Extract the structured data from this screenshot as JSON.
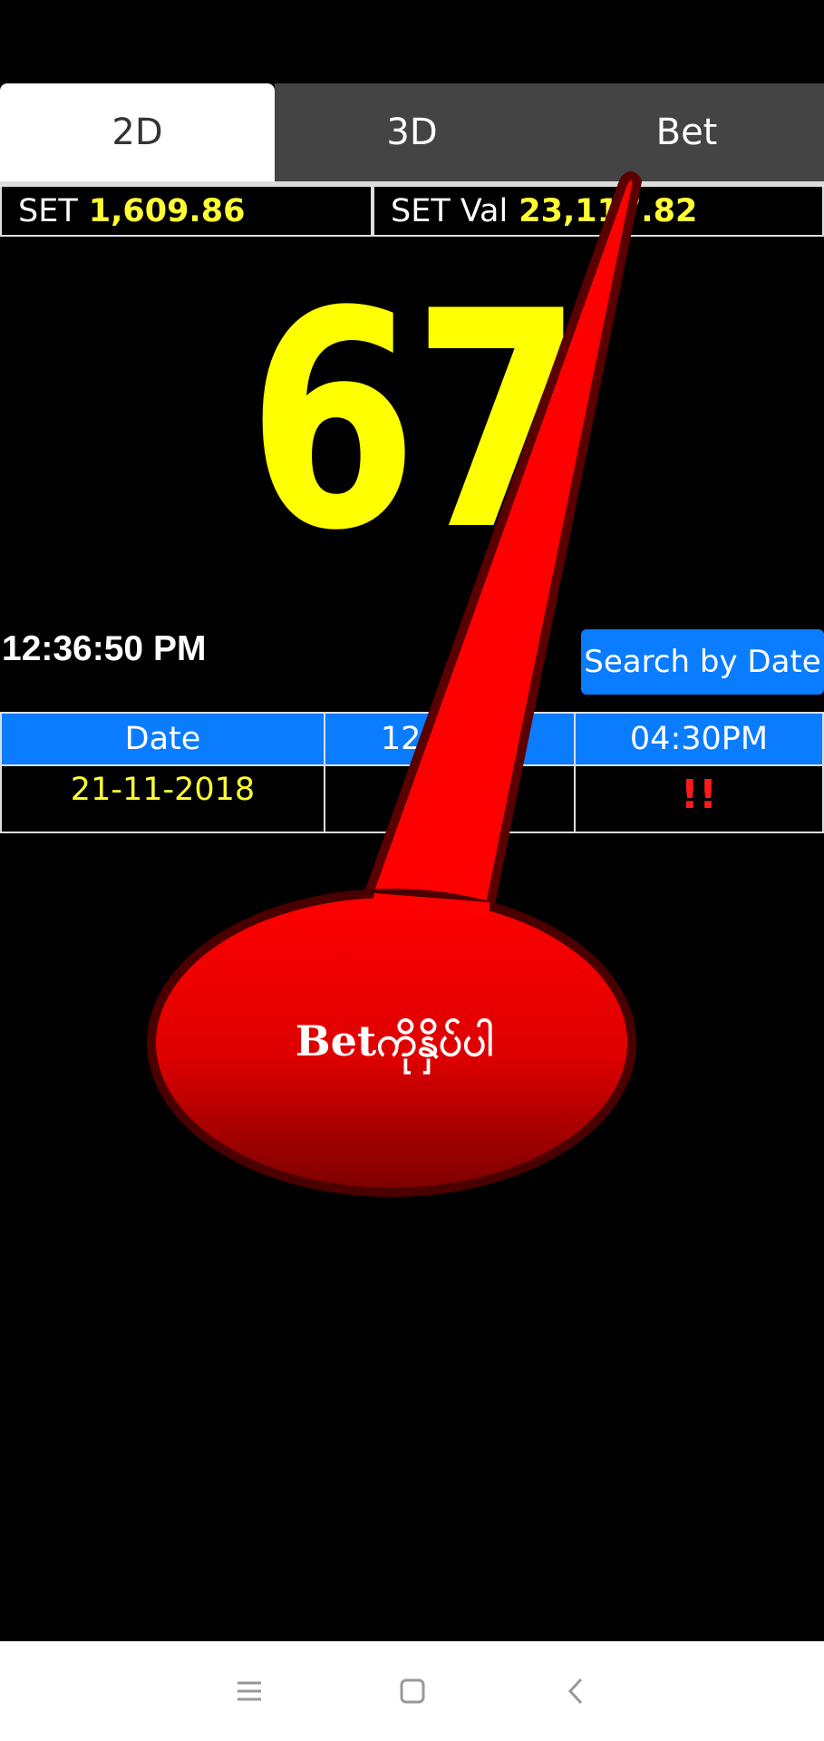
{
  "tabs": [
    {
      "label": "2D",
      "active": true
    },
    {
      "label": "3D",
      "active": false
    },
    {
      "label": "Bet",
      "active": false
    }
  ],
  "set_info": {
    "set_label": "SET",
    "set_value": "1,609.86",
    "set_val_label": "SET Val",
    "set_val_value": "23,117.82"
  },
  "result_number": "67",
  "clock": "12:36:50 PM",
  "search_button": "Search by Date",
  "results_table": {
    "headers": [
      "Date",
      "12:01PM",
      "04:30PM"
    ],
    "rows": [
      {
        "date": "21-11-2018",
        "noon": "",
        "evening": "!!"
      }
    ]
  },
  "callout": {
    "text": "Betကိုနှိပ်ပါ",
    "color": "#ff0000"
  },
  "colors": {
    "accent_blue": "#0a7cff",
    "highlight_yellow": "#ffff00"
  },
  "navbar": {
    "icons": [
      "menu-icon",
      "home-icon",
      "back-icon"
    ]
  }
}
